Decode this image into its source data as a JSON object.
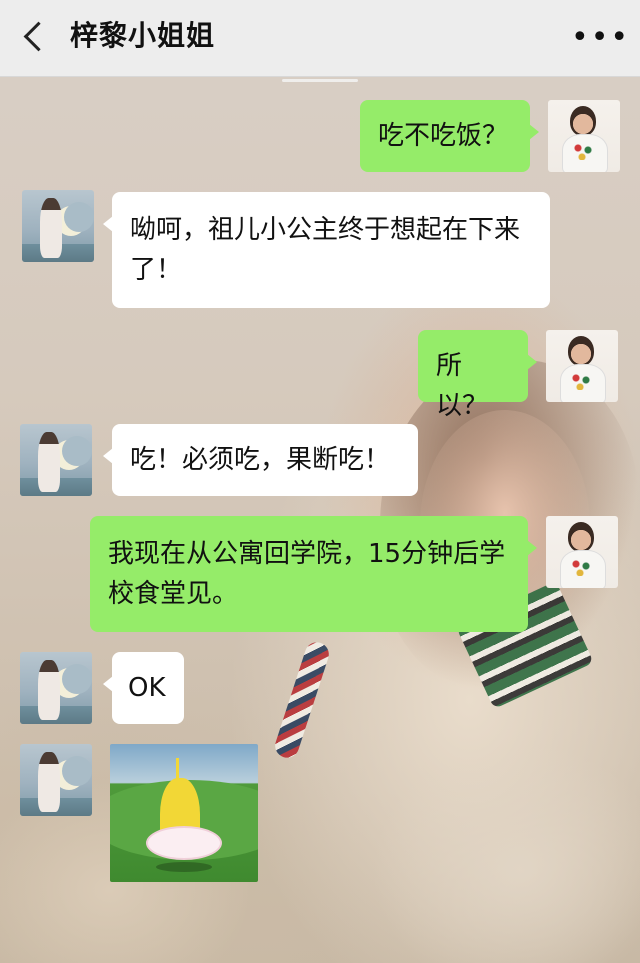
{
  "header": {
    "title": "梓黎小姐姐"
  },
  "messages": [
    {
      "sender": "me",
      "text": "吃不吃饭？"
    },
    {
      "sender": "her",
      "text": "呦呵，祖儿小公主终于想起在下来了！"
    },
    {
      "sender": "me",
      "text": "所以？"
    },
    {
      "sender": "her",
      "text": "吃！必须吃，果断吃！"
    },
    {
      "sender": "me",
      "text": "我现在从公寓回学院，15分钟后学校食堂见。"
    },
    {
      "sender": "her",
      "text": "OK"
    },
    {
      "sender": "her",
      "type": "sticker"
    }
  ],
  "colors": {
    "my_bubble": "#95ec69",
    "their_bubble": "#ffffff",
    "header_bg": "#ededed"
  },
  "icons": {
    "back": "chevron-left-icon",
    "more": "more-options-icon"
  }
}
